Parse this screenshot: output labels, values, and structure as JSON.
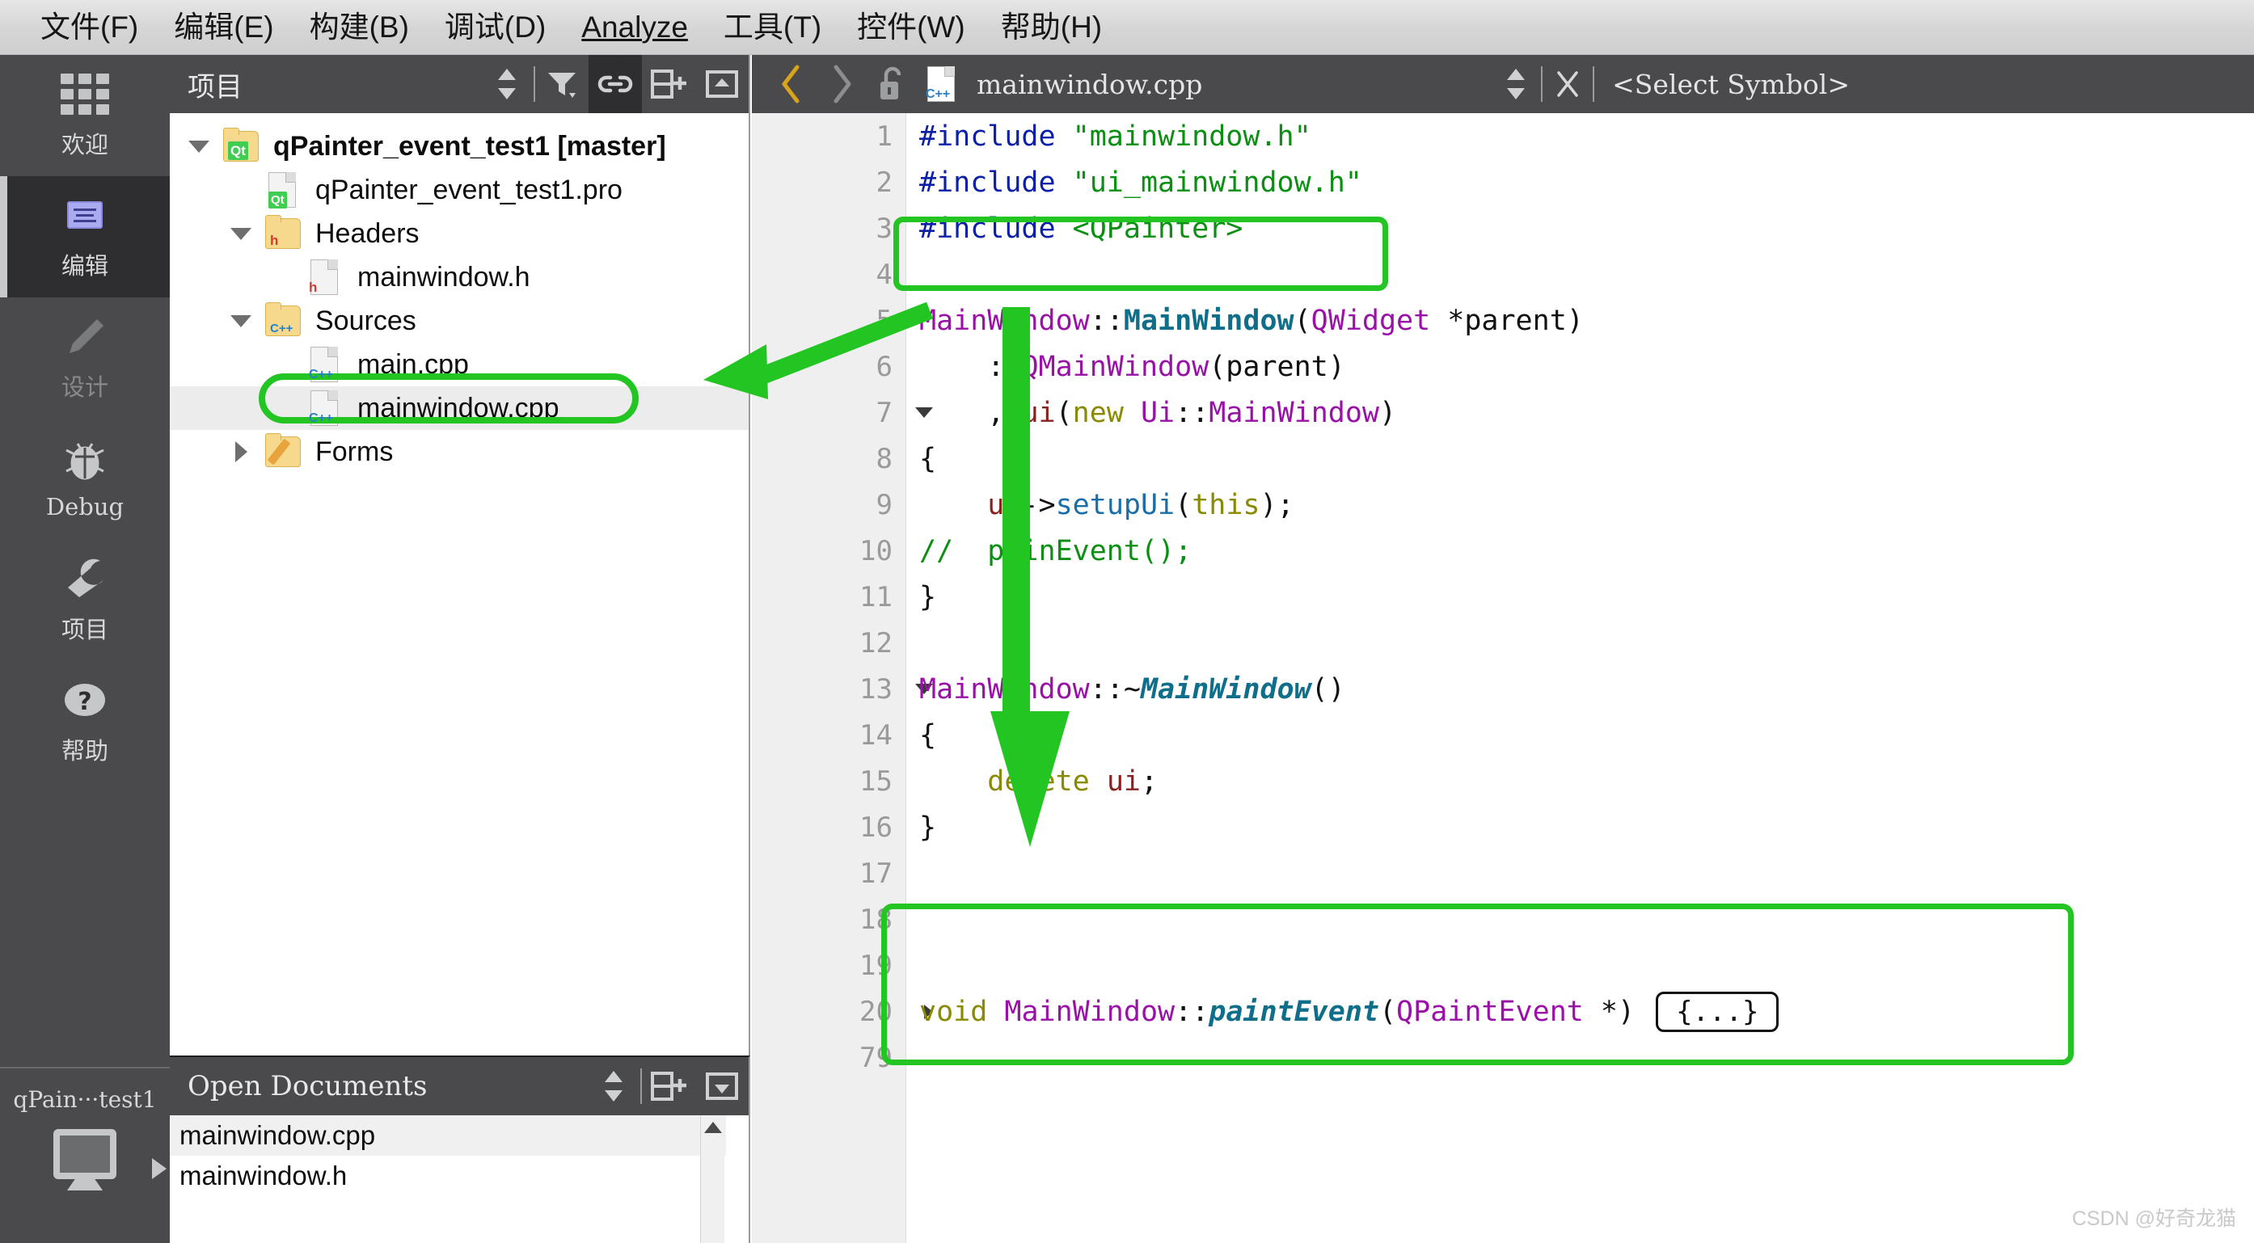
{
  "menu": {
    "items": [
      {
        "label": "文件(F)",
        "mnemonic": "F"
      },
      {
        "label": "编辑(E)",
        "mnemonic": "E"
      },
      {
        "label": "构建(B)",
        "mnemonic": "B"
      },
      {
        "label": "调试(D)",
        "mnemonic": "D"
      },
      {
        "label": "Analyze",
        "mnemonic": "A"
      },
      {
        "label": "工具(T)",
        "mnemonic": "T"
      },
      {
        "label": "控件(W)",
        "mnemonic": "W"
      },
      {
        "label": "帮助(H)",
        "mnemonic": "H"
      }
    ]
  },
  "modebar": {
    "items": [
      {
        "label": "欢迎",
        "icon": "grid-icon",
        "state": "normal"
      },
      {
        "label": "编辑",
        "icon": "edit-document-icon",
        "state": "active"
      },
      {
        "label": "设计",
        "icon": "pencil-icon",
        "state": "disabled"
      },
      {
        "label": "Debug",
        "icon": "bug-icon",
        "state": "normal"
      },
      {
        "label": "项目",
        "icon": "wrench-icon",
        "state": "normal"
      },
      {
        "label": "帮助",
        "icon": "question-mark-icon",
        "state": "normal"
      }
    ]
  },
  "kit_selector": {
    "label": "qPain···test1",
    "icon": "monitor-icon",
    "expand_icon": "triangle-right-icon"
  },
  "project_panel": {
    "title": "项目",
    "toolbar": [
      {
        "name": "sync-selection-icon",
        "label": "",
        "selected": false
      },
      {
        "name": "filter-icon",
        "label": "",
        "selected": false
      },
      {
        "name": "link-icon",
        "label": "",
        "selected": true
      },
      {
        "name": "split-add-icon",
        "label": "",
        "selected": false
      },
      {
        "name": "collapse-icon",
        "label": "",
        "selected": false
      }
    ],
    "tree": [
      {
        "label": "qPainter_event_test1 [master]",
        "depth": 0,
        "icon": "qt-project-folder-icon",
        "twisty": "down",
        "bold": true,
        "selected": false
      },
      {
        "label": "qPainter_event_test1.pro",
        "depth": 1,
        "icon": "qt-pro-file-icon",
        "twisty": "none",
        "bold": false,
        "selected": false
      },
      {
        "label": "Headers",
        "depth": 1,
        "icon": "headers-folder-icon",
        "twisty": "down",
        "bold": false,
        "selected": false
      },
      {
        "label": "mainwindow.h",
        "depth": 2,
        "icon": "h-file-icon",
        "twisty": "none",
        "bold": false,
        "selected": false
      },
      {
        "label": "Sources",
        "depth": 1,
        "icon": "sources-folder-icon",
        "twisty": "down",
        "bold": false,
        "selected": false
      },
      {
        "label": "main.cpp",
        "depth": 2,
        "icon": "cpp-file-icon",
        "twisty": "none",
        "bold": false,
        "selected": false
      },
      {
        "label": "mainwindow.cpp",
        "depth": 2,
        "icon": "cpp-file-icon",
        "twisty": "none",
        "bold": false,
        "selected": true
      },
      {
        "label": "Forms",
        "depth": 1,
        "icon": "forms-folder-icon",
        "twisty": "right",
        "bold": false,
        "selected": false
      }
    ]
  },
  "open_documents": {
    "title": "Open Documents",
    "toolbar": [
      {
        "name": "sort-icon",
        "selected": false
      },
      {
        "name": "split-add-icon",
        "selected": false
      },
      {
        "name": "close-panel-icon",
        "selected": false
      }
    ],
    "items": [
      {
        "label": "mainwindow.cpp",
        "selected": true
      },
      {
        "label": "mainwindow.h",
        "selected": false
      }
    ]
  },
  "editor_toolbar": {
    "back_icon": "back-arrow-icon",
    "forward_icon": "forward-arrow-icon",
    "lock_icon": "unlocked-padlock-icon",
    "file_icon": "cpp-file-icon",
    "filename": "mainwindow.cpp",
    "updown_icon": "updown-arrows-icon",
    "close_icon": "close-x-icon",
    "symbol_selector": "<Select Symbol>"
  },
  "code": {
    "lines": [
      {
        "num": "1",
        "fold": "none",
        "tokens": [
          {
            "t": "#include ",
            "c": "c-pre"
          },
          {
            "t": "\"mainwindow.h\"",
            "c": "c-str"
          }
        ]
      },
      {
        "num": "2",
        "fold": "none",
        "tokens": [
          {
            "t": "#include ",
            "c": "c-pre"
          },
          {
            "t": "\"ui_mainwindow.h\"",
            "c": "c-str"
          }
        ]
      },
      {
        "num": "3",
        "fold": "none",
        "tokens": [
          {
            "t": "#include ",
            "c": "c-pre"
          },
          {
            "t": "<QPainter>",
            "c": "c-str"
          }
        ]
      },
      {
        "num": "4",
        "fold": "none",
        "tokens": []
      },
      {
        "num": "5",
        "fold": "none",
        "tokens": [
          {
            "t": "MainWindow",
            "c": "c-type"
          },
          {
            "t": "::",
            "c": "c-plain"
          },
          {
            "t": "MainWindow",
            "c": "c-fn"
          },
          {
            "t": "(",
            "c": "c-plain"
          },
          {
            "t": "QWidget",
            "c": "c-type"
          },
          {
            "t": " *parent",
            "c": "c-plain"
          },
          {
            "t": ")",
            "c": "c-plain"
          }
        ]
      },
      {
        "num": "6",
        "fold": "none",
        "tokens": [
          {
            "t": "    : ",
            "c": "c-plain"
          },
          {
            "t": "QMainWindow",
            "c": "c-type"
          },
          {
            "t": "(parent)",
            "c": "c-plain"
          }
        ]
      },
      {
        "num": "7",
        "fold": "down",
        "tokens": [
          {
            "t": "    , ",
            "c": "c-plain"
          },
          {
            "t": "ui",
            "c": "c-var"
          },
          {
            "t": "(",
            "c": "c-plain"
          },
          {
            "t": "new",
            "c": "c-kw"
          },
          {
            "t": " ",
            "c": "c-plain"
          },
          {
            "t": "Ui",
            "c": "c-type"
          },
          {
            "t": "::",
            "c": "c-plain"
          },
          {
            "t": "MainWindow",
            "c": "c-type"
          },
          {
            "t": ")",
            "c": "c-plain"
          }
        ]
      },
      {
        "num": "8",
        "fold": "none",
        "tokens": [
          {
            "t": "{",
            "c": "c-plain"
          }
        ]
      },
      {
        "num": "9",
        "fold": "none",
        "tokens": [
          {
            "t": "    ",
            "c": "c-plain"
          },
          {
            "t": "ui",
            "c": "c-var"
          },
          {
            "t": "->",
            "c": "c-plain"
          },
          {
            "t": "setupUi",
            "c": "c-call"
          },
          {
            "t": "(",
            "c": "c-plain"
          },
          {
            "t": "this",
            "c": "c-kw"
          },
          {
            "t": ");",
            "c": "c-plain"
          }
        ]
      },
      {
        "num": "10",
        "fold": "none",
        "tokens": [
          {
            "t": "//  painEvent();",
            "c": "c-cmt"
          }
        ]
      },
      {
        "num": "11",
        "fold": "none",
        "tokens": [
          {
            "t": "}",
            "c": "c-plain"
          }
        ]
      },
      {
        "num": "12",
        "fold": "none",
        "tokens": []
      },
      {
        "num": "13",
        "fold": "down",
        "tokens": [
          {
            "t": "MainWindow",
            "c": "c-type"
          },
          {
            "t": "::~",
            "c": "c-plain"
          },
          {
            "t": "MainWindow",
            "c": "c-fni"
          },
          {
            "t": "()",
            "c": "c-plain"
          }
        ]
      },
      {
        "num": "14",
        "fold": "none",
        "tokens": [
          {
            "t": "{",
            "c": "c-plain"
          }
        ]
      },
      {
        "num": "15",
        "fold": "none",
        "tokens": [
          {
            "t": "    ",
            "c": "c-plain"
          },
          {
            "t": "delete",
            "c": "c-kw"
          },
          {
            "t": " ",
            "c": "c-plain"
          },
          {
            "t": "ui",
            "c": "c-var"
          },
          {
            "t": ";",
            "c": "c-plain"
          }
        ]
      },
      {
        "num": "16",
        "fold": "none",
        "tokens": [
          {
            "t": "}",
            "c": "c-plain"
          }
        ]
      },
      {
        "num": "17",
        "fold": "none",
        "tokens": []
      },
      {
        "num": "18",
        "fold": "none",
        "tokens": []
      },
      {
        "num": "19",
        "fold": "none",
        "tokens": []
      },
      {
        "num": "20",
        "fold": "right",
        "tokens": [
          {
            "t": "void",
            "c": "c-kw"
          },
          {
            "t": " ",
            "c": "c-plain"
          },
          {
            "t": "MainWindow",
            "c": "c-type"
          },
          {
            "t": "::",
            "c": "c-plain"
          },
          {
            "t": "paintEvent",
            "c": "c-fni"
          },
          {
            "t": "(",
            "c": "c-plain"
          },
          {
            "t": "QPaintEvent",
            "c": "c-type"
          },
          {
            "t": " *",
            "c": "c-plain"
          },
          {
            "t": ")",
            "c": "c-plain"
          }
        ],
        "fold_box": "{...}"
      },
      {
        "num": "79",
        "fold": "none",
        "tokens": []
      }
    ]
  },
  "annotations": {
    "accent_color": "#22c522",
    "highlight_include_line": "#include <QPainter>",
    "highlight_tree_item": "mainwindow.cpp",
    "highlight_paint_event": "void MainWindow::paintEvent(QPaintEvent *)  {...}",
    "arrow_to_tree": "arrow-pointing-to-mainwindow-cpp",
    "arrow_down": "arrow-pointing-down-to-paintevent"
  },
  "watermark": "CSDN @好奇龙猫"
}
